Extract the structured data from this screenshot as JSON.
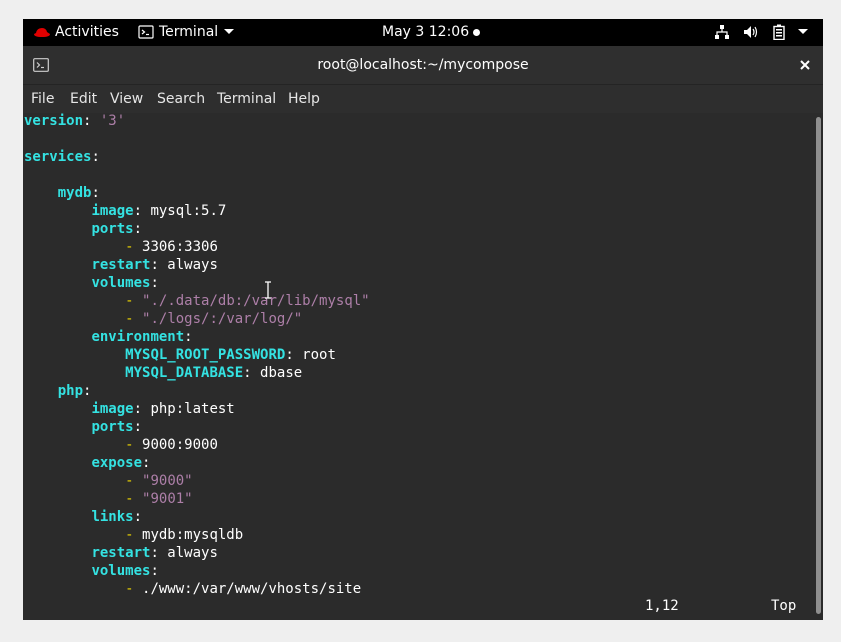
{
  "topbar": {
    "activities": "Activities",
    "app_menu": "Terminal",
    "datetime": "May 3  12:06"
  },
  "window": {
    "title": "root@localhost:~/mycompose"
  },
  "menu": [
    "File",
    "Edit",
    "View",
    "Search",
    "Terminal",
    "Help"
  ],
  "editor": {
    "lines": [
      [
        [
          "k",
          "version"
        ],
        [
          "n",
          ": "
        ],
        [
          "s",
          "'3'"
        ]
      ],
      [],
      [
        [
          "k",
          "services"
        ],
        [
          "n",
          ":"
        ]
      ],
      [],
      [
        [
          "n",
          "    "
        ],
        [
          "k",
          "mydb"
        ],
        [
          "n",
          ":"
        ]
      ],
      [
        [
          "n",
          "        "
        ],
        [
          "k",
          "image"
        ],
        [
          "n",
          ": mysql:5.7"
        ]
      ],
      [
        [
          "n",
          "        "
        ],
        [
          "k",
          "ports"
        ],
        [
          "n",
          ":"
        ]
      ],
      [
        [
          "n",
          "            "
        ],
        [
          "d",
          "-"
        ],
        [
          "n",
          " 3306:3306"
        ]
      ],
      [
        [
          "n",
          "        "
        ],
        [
          "k",
          "restart"
        ],
        [
          "n",
          ": always"
        ]
      ],
      [
        [
          "n",
          "        "
        ],
        [
          "k",
          "volumes"
        ],
        [
          "n",
          ":"
        ]
      ],
      [
        [
          "n",
          "            "
        ],
        [
          "d",
          "-"
        ],
        [
          "n",
          " "
        ],
        [
          "s",
          "\"./.data/db:/var/lib/mysql\""
        ]
      ],
      [
        [
          "n",
          "            "
        ],
        [
          "d",
          "-"
        ],
        [
          "n",
          " "
        ],
        [
          "s",
          "\"./logs/:/var/log/\""
        ]
      ],
      [
        [
          "n",
          "        "
        ],
        [
          "k",
          "environment"
        ],
        [
          "n",
          ":"
        ]
      ],
      [
        [
          "n",
          "            "
        ],
        [
          "k",
          "MYSQL_ROOT_PASSWORD"
        ],
        [
          "n",
          ": root"
        ]
      ],
      [
        [
          "n",
          "            "
        ],
        [
          "k",
          "MYSQL_DATABASE"
        ],
        [
          "n",
          ": dbase"
        ]
      ],
      [
        [
          "n",
          "    "
        ],
        [
          "k",
          "php"
        ],
        [
          "n",
          ":"
        ]
      ],
      [
        [
          "n",
          "        "
        ],
        [
          "k",
          "image"
        ],
        [
          "n",
          ": php:latest"
        ]
      ],
      [
        [
          "n",
          "        "
        ],
        [
          "k",
          "ports"
        ],
        [
          "n",
          ":"
        ]
      ],
      [
        [
          "n",
          "            "
        ],
        [
          "d",
          "-"
        ],
        [
          "n",
          " 9000:9000"
        ]
      ],
      [
        [
          "n",
          "        "
        ],
        [
          "k",
          "expose"
        ],
        [
          "n",
          ":"
        ]
      ],
      [
        [
          "n",
          "            "
        ],
        [
          "d",
          "-"
        ],
        [
          "n",
          " "
        ],
        [
          "s",
          "\"9000\""
        ]
      ],
      [
        [
          "n",
          "            "
        ],
        [
          "d",
          "-"
        ],
        [
          "n",
          " "
        ],
        [
          "s",
          "\"9001\""
        ]
      ],
      [
        [
          "n",
          "        "
        ],
        [
          "k",
          "links"
        ],
        [
          "n",
          ":"
        ]
      ],
      [
        [
          "n",
          "            "
        ],
        [
          "d",
          "-"
        ],
        [
          "n",
          " mydb:mysqldb"
        ]
      ],
      [
        [
          "n",
          "        "
        ],
        [
          "k",
          "restart"
        ],
        [
          "n",
          ": always"
        ]
      ],
      [
        [
          "n",
          "        "
        ],
        [
          "k",
          "volumes"
        ],
        [
          "n",
          ":"
        ]
      ],
      [
        [
          "n",
          "            "
        ],
        [
          "d",
          "-"
        ],
        [
          "n",
          " ./www:/var/www/vhosts/site"
        ]
      ]
    ]
  },
  "status": {
    "position": "1,12",
    "scroll": "Top"
  }
}
